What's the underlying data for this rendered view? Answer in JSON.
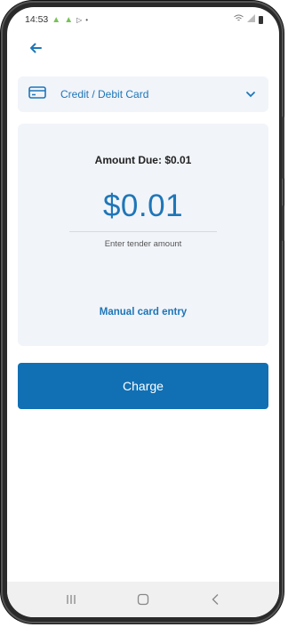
{
  "status_bar": {
    "time": "14:53",
    "icons": [
      "android-icon",
      "android-icon",
      "play-icon",
      "dot-icon"
    ],
    "right_icons": [
      "wifi-icon",
      "signal-icon",
      "battery-icon"
    ]
  },
  "payment_method": {
    "label": "Credit / Debit Card",
    "icon": "credit-card-icon",
    "dropdown_icon": "chevron-down-icon"
  },
  "amount_panel": {
    "amount_due_label": "Amount Due: $0.01",
    "amount_value": "$0.01",
    "tender_hint": "Enter tender amount",
    "manual_entry_label": "Manual card entry"
  },
  "charge_button": {
    "label": "Charge"
  },
  "colors": {
    "accent": "#1e76b8",
    "charge_button": "#1170b4",
    "panel_bg": "#f1f4f9"
  }
}
